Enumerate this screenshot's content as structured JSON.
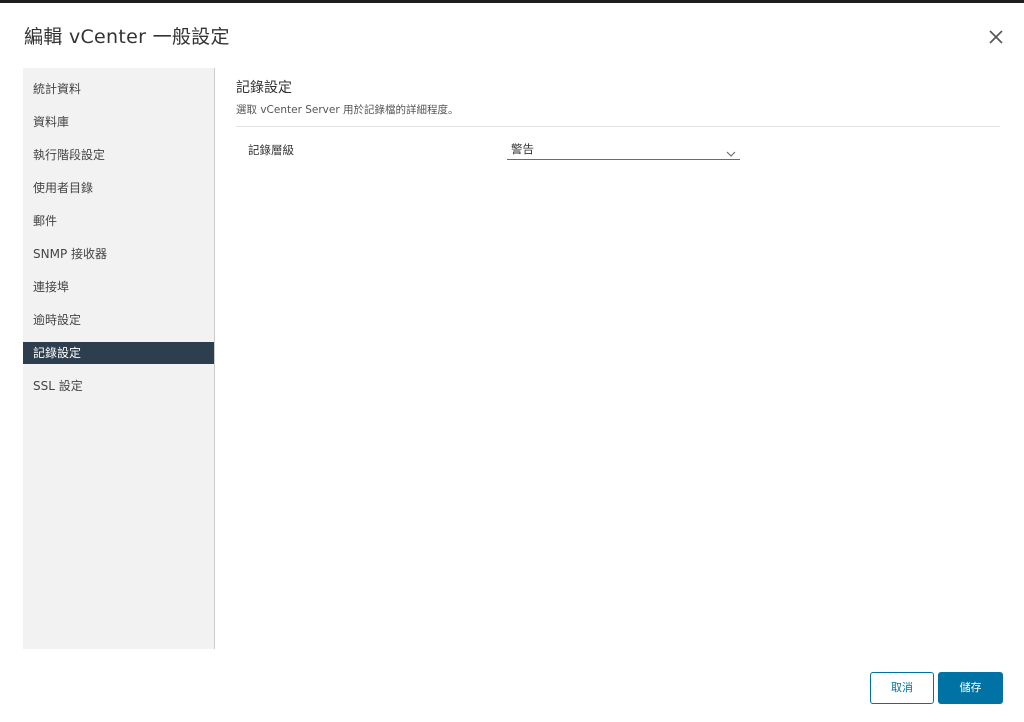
{
  "dialog": {
    "title": "編輯 vCenter 一般設定",
    "close_icon": "close-icon"
  },
  "sidebar": {
    "items": [
      {
        "label": "統計資料",
        "active": false
      },
      {
        "label": "資料庫",
        "active": false
      },
      {
        "label": "執行階段設定",
        "active": false
      },
      {
        "label": "使用者目錄",
        "active": false
      },
      {
        "label": "郵件",
        "active": false
      },
      {
        "label": "SNMP 接收器",
        "active": false
      },
      {
        "label": "連接埠",
        "active": false
      },
      {
        "label": "逾時設定",
        "active": false
      },
      {
        "label": "記錄設定",
        "active": true
      },
      {
        "label": "SSL 設定",
        "active": false
      }
    ]
  },
  "main": {
    "section_title": "記錄設定",
    "section_description": "選取 vCenter Server 用於記錄檔的詳細程度。",
    "field_label": "記錄層級",
    "field_value": "警告",
    "chevron_icon": "chevron-down-icon"
  },
  "footer": {
    "cancel_label": "取消",
    "save_label": "儲存"
  },
  "colors": {
    "active_item_bg": "#2d3e4f",
    "primary": "#0072a3",
    "sidebar_bg": "#f2f2f2"
  }
}
